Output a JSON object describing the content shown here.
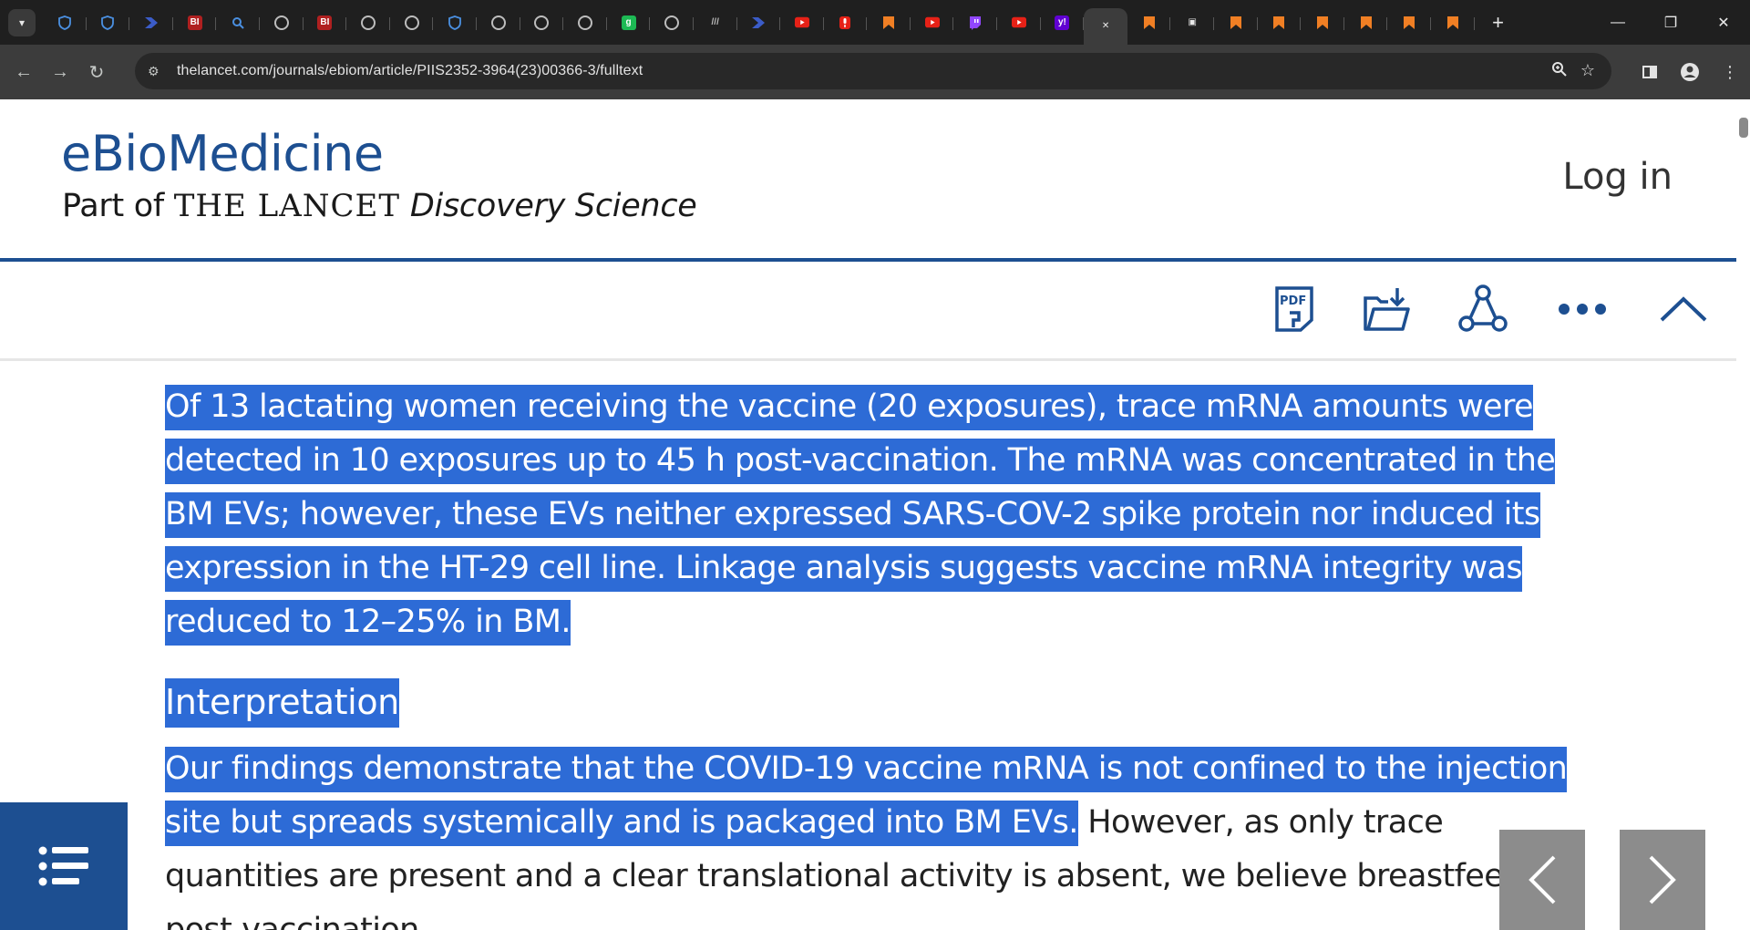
{
  "browser": {
    "tabs": [
      {
        "icon": "shield-favicon",
        "color": "#4a8fe0"
      },
      {
        "icon": "shield-favicon",
        "color": "#4a8fe0"
      },
      {
        "icon": "arrow-favicon",
        "color": "#3b5cc8"
      },
      {
        "icon": "bi-favicon",
        "label": "BI",
        "color": "#b02020"
      },
      {
        "icon": "search-favicon",
        "color": "#4a8fe0"
      },
      {
        "icon": "globe-favicon",
        "color": "#bdbdbd"
      },
      {
        "icon": "bi-favicon",
        "label": "BI",
        "color": "#b02020"
      },
      {
        "icon": "globe-favicon",
        "color": "#bdbdbd"
      },
      {
        "icon": "globe-favicon",
        "color": "#bdbdbd"
      },
      {
        "icon": "shield-favicon",
        "color": "#4a8fe0"
      },
      {
        "icon": "globe-favicon",
        "color": "#bdbdbd"
      },
      {
        "icon": "globe-favicon",
        "color": "#bdbdbd"
      },
      {
        "icon": "globe-favicon",
        "color": "#bdbdbd"
      },
      {
        "icon": "g-favicon",
        "label": "g",
        "color": "#1db954"
      },
      {
        "icon": "globe-favicon",
        "color": "#bdbdbd"
      },
      {
        "icon": "slash-favicon",
        "label": "///",
        "color": "#bdbdbd"
      },
      {
        "icon": "arrow-favicon",
        "color": "#3b5cc8"
      },
      {
        "icon": "youtube-favicon",
        "color": "#e62117"
      },
      {
        "icon": "mic-favicon",
        "color": "#e62117"
      },
      {
        "icon": "bookmark-favicon",
        "color": "#f07f24"
      },
      {
        "icon": "youtube-favicon",
        "color": "#e62117"
      },
      {
        "icon": "twitch-favicon",
        "color": "#9146ff"
      },
      {
        "icon": "youtube-favicon",
        "color": "#e62117"
      },
      {
        "icon": "yahoo-favicon",
        "label": "y!",
        "color": "#6001d2"
      },
      {
        "icon": "close-icon",
        "label": "✕",
        "color": "#e8e8e8",
        "active": true
      },
      {
        "icon": "bookmark-favicon",
        "color": "#f07f24"
      },
      {
        "icon": "box-favicon",
        "label": "▣",
        "color": "#e8e8e8"
      },
      {
        "icon": "bookmark-favicon",
        "color": "#f07f24"
      },
      {
        "icon": "bookmark-favicon",
        "color": "#f07f24"
      },
      {
        "icon": "bookmark-favicon",
        "color": "#f07f24"
      },
      {
        "icon": "bookmark-favicon",
        "color": "#f07f24"
      },
      {
        "icon": "bookmark-favicon",
        "color": "#f07f24"
      },
      {
        "icon": "bookmark-favicon",
        "color": "#f07f24"
      }
    ],
    "url": "thelancet.com/journals/ebiom/article/PIIS2352-3964(23)00366-3/fulltext"
  },
  "site": {
    "title": "eBioMedicine",
    "subtitle_prefix": "Part of ",
    "subtitle_lancet": "THE LANCET",
    "subtitle_suffix": " Discovery Science",
    "login": "Log in"
  },
  "article": {
    "para1": "Of 13 lactating women receiving the vaccine (20 exposures), trace mRNA amounts were detected in 10 exposures up to 45 h post-vaccination. The mRNA was concentrated in the BM EVs; however, these EVs neither expressed SARS-COV-2 spike protein nor induced its expression in the HT-29 cell line. Linkage analysis suggests vaccine mRNA integrity was reduced to 12–25% in BM.",
    "heading": "Interpretation",
    "para2_highlighted": "Our findings demonstrate that the COVID-19 vaccine mRNA is not confined to the injection site but spreads systemically and is packaged into BM EVs.",
    "para2_rest": " However, as only trace quantities are present and a clear translational activity is absent, we believe breastfeeding post-vaccination"
  },
  "colors": {
    "brand": "#1d4f91",
    "selection": "#2d6bd6"
  }
}
